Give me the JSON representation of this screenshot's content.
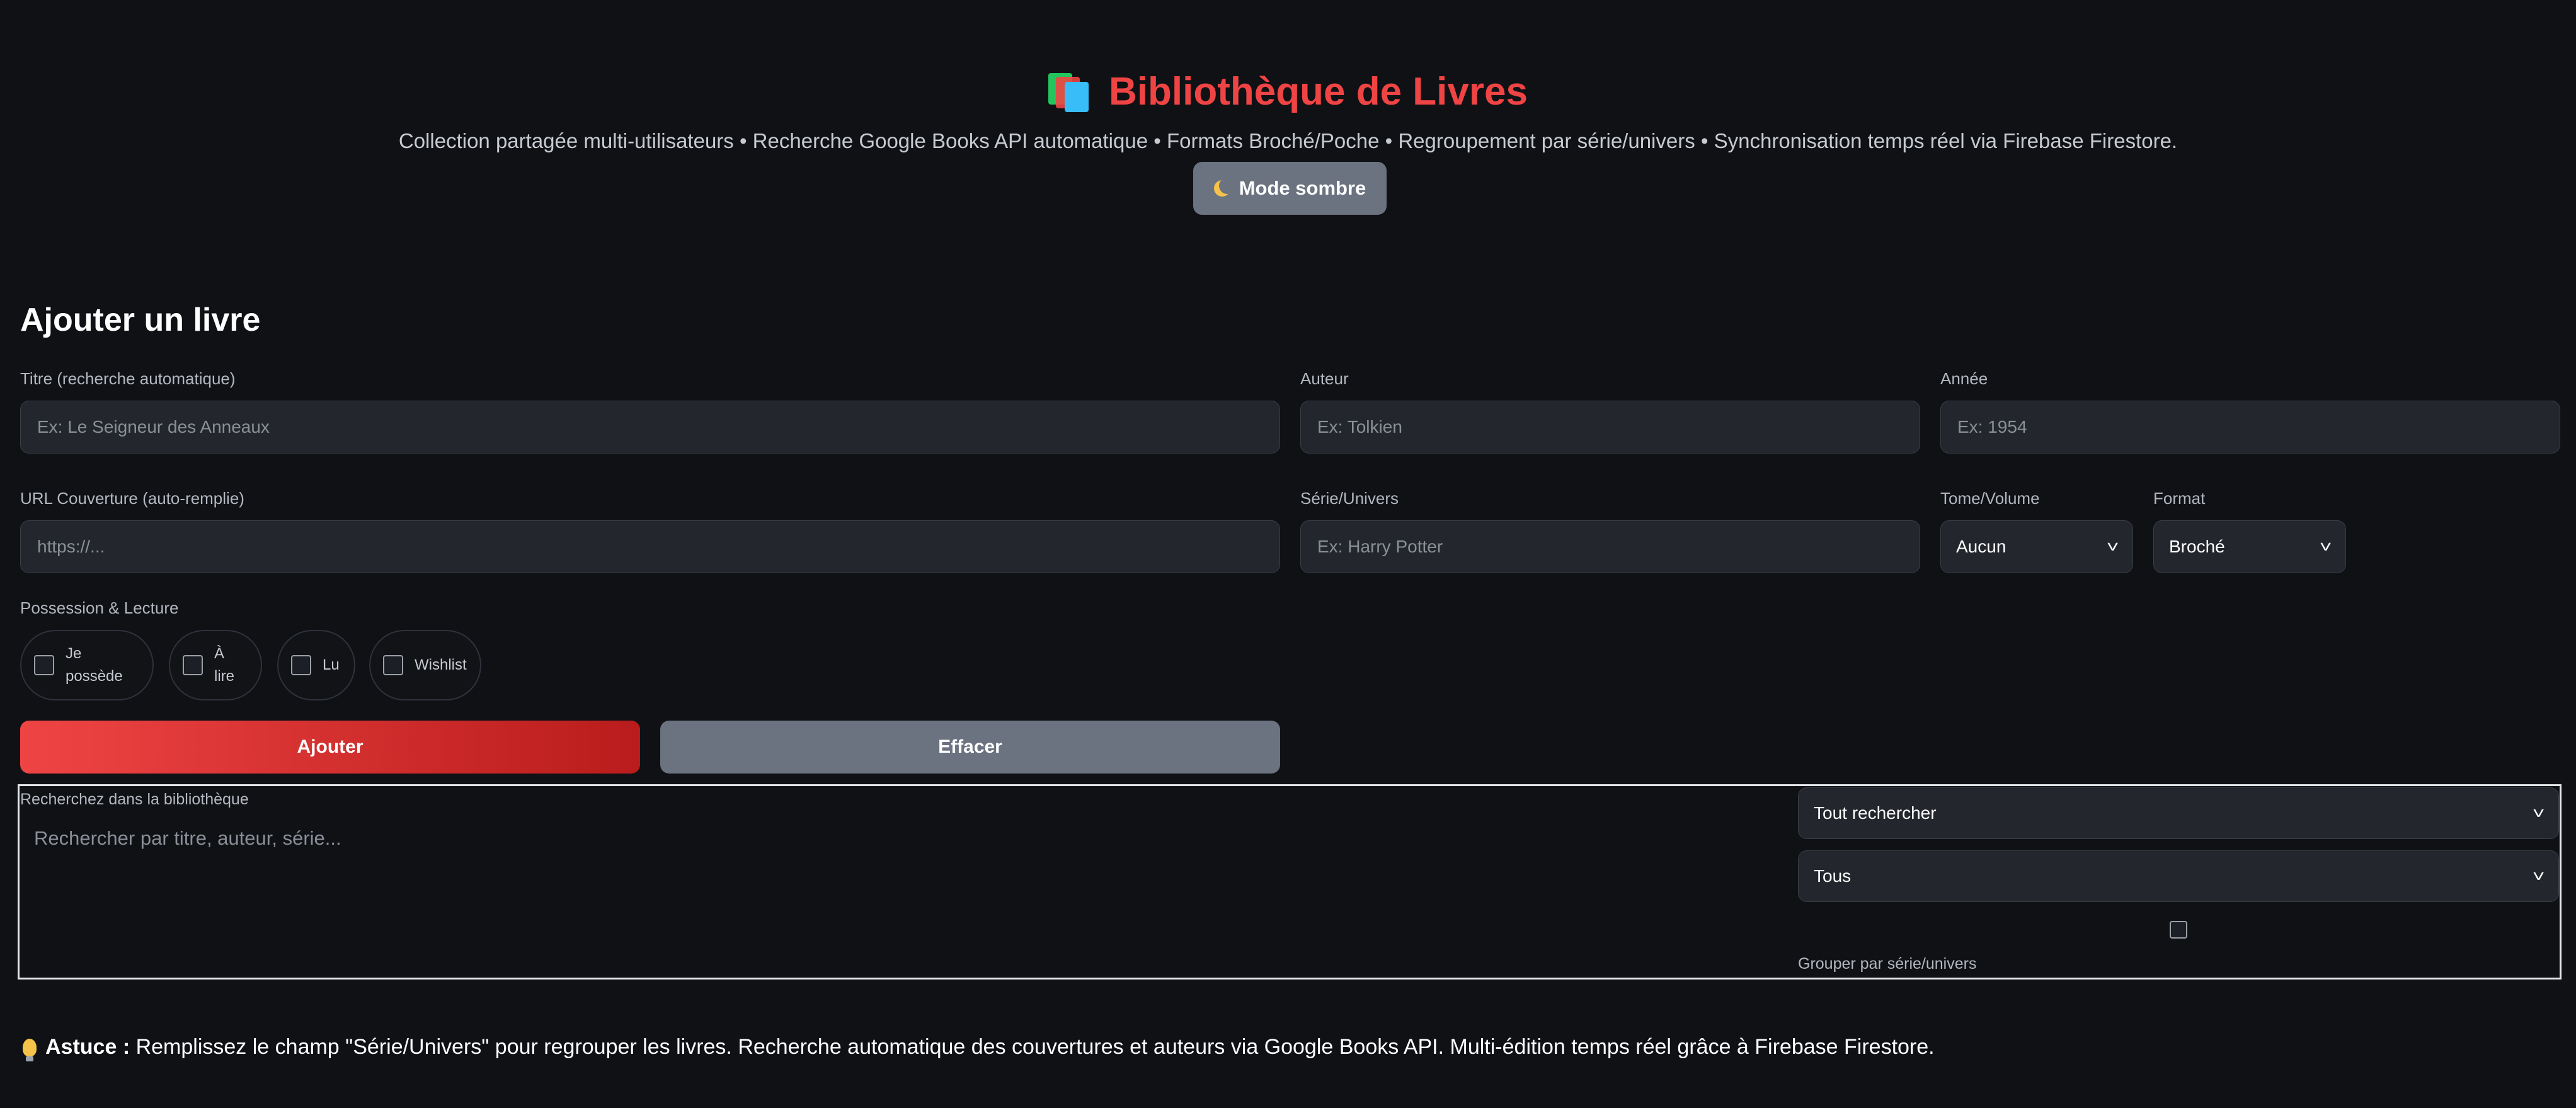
{
  "header": {
    "title": "Bibliothèque de Livres",
    "subtitle": "Collection partagée multi-utilisateurs • Recherche Google Books API automatique • Formats Broché/Poche • Regroupement par série/univers • Synchronisation temps réel via Firebase Firestore.",
    "theme_button": "Mode sombre"
  },
  "form": {
    "section_title": "Ajouter un livre",
    "title_label": "Titre (recherche automatique)",
    "title_placeholder": "Ex: Le Seigneur des Anneaux",
    "author_label": "Auteur",
    "author_placeholder": "Ex: Tolkien",
    "year_label": "Année",
    "year_placeholder": "Ex: 1954",
    "cover_label": "URL Couverture (auto-remplie)",
    "cover_placeholder": "https://...",
    "series_label": "Série/Univers",
    "series_placeholder": "Ex: Harry Potter",
    "volume_label": "Tome/Volume",
    "volume_value": "Aucun",
    "format_label": "Format",
    "format_value": "Broché",
    "possession_label": "Possession & Lecture",
    "checks": {
      "owned_1": "Je",
      "owned_2": "possède",
      "toread_1": "À",
      "toread_2": "lire",
      "read": "Lu",
      "wishlist": "Wishlist"
    },
    "add_button": "Ajouter",
    "clear_button": "Effacer"
  },
  "search": {
    "label": "Recherchez dans la bibliothèque",
    "placeholder": "Rechercher par titre, auteur, série...",
    "scope_value": "Tout rechercher",
    "filter_value": "Tous",
    "group_label": "Grouper par série/univers"
  },
  "tip": {
    "strong": "Astuce :",
    "text": "Remplissez le champ \"Série/Univers\" pour regrouper les livres. Recherche automatique des couvertures et auteurs via Google Books API. Multi-édition temps réel grâce à Firebase Firestore."
  },
  "colors": {
    "accent": "#ef4444",
    "background": "#0f1115",
    "field": "#23262d",
    "secondary_button": "#6b7280"
  }
}
